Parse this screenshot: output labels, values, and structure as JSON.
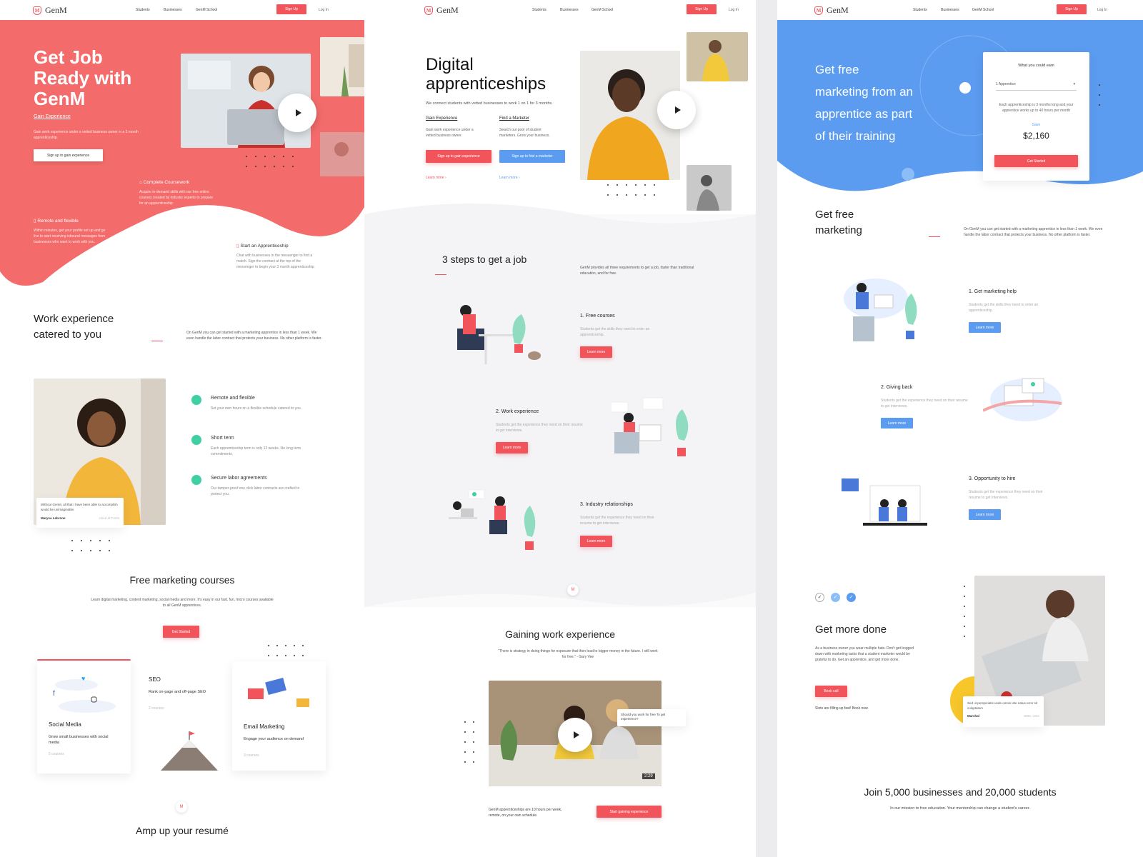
{
  "brand": {
    "name": "GenM"
  },
  "nav": {
    "students": "Students",
    "businesses": "Businesses",
    "school": "GenM School",
    "signup": "Sign Up",
    "login": "Log In"
  },
  "p1": {
    "hero_title_1": "Get Job",
    "hero_title_2": "Ready with",
    "hero_title_3": "GenM",
    "gain": "Gain Experience",
    "gain_text": "Gain work experience under a vetted business owner in a 3 month apprenticeship.",
    "gain_btn": "Sign up to gain experience",
    "coursework": "Complete Coursework",
    "coursework_text": "Acquire in-demand skills with our free online courses created by industry experts to prepare for an apprenticeship.",
    "remote": "Remote and flexible",
    "remote_text": "Within minutes, get your profile set up and go live to start receiving inbound messages from businesses who want to work with you.",
    "start": "Start an Apprenticeship",
    "start_text": "Chat with businesses in the messenger to find a match. Sign the contract at the top of the messenger to begin your 3 month apprenticeship.",
    "work_title_1": "Work experience",
    "work_title_2": "catered to you",
    "work_text": "On GenM you can get started with a marketing apprentice in less than 1 week. We even handle the labor contract that protects your business. No other platform is faster.",
    "quote": "Without GenM, all that I have been able to accomplish would be unimaginable.",
    "quote_name": "Marysa Lebrone",
    "quote_role": "Hired at Forza",
    "f1": "Remote and flexible",
    "f1_text": "Set your own hours on a flexible schedule catered to you.",
    "f2": "Short term",
    "f2_text": "Each apprenticeship term is only 12 weeks. No long term commitments.",
    "f3": "Secure labor agreements",
    "f3_text": "Our tamper-proof one click labor contracts are crafted to protect you.",
    "courses_title": "Free marketing courses",
    "courses_text": "Learn digital marketing, content marketing, social media and more. It's easy in our fast, fun, micro courses available to all GenM apprentices.",
    "courses_btn": "Get Started",
    "c1_title": "Social Media",
    "c1_sub": "Grow small businesses with social media",
    "c1_count": "5 courses",
    "c2_title": "SEO",
    "c2_sub": "Rank on-page and off-page SEO",
    "c2_count": "2 courses",
    "c3_title": "Email Marketing",
    "c3_sub": "Engage your audience on demand",
    "c3_count": "3 courses",
    "amp": "Amp up your resumé"
  },
  "p2": {
    "hero_1": "Digital",
    "hero_2": "apprenticeships",
    "hero_text": "We connect students with vetted businesses to work 1 on 1 for 3 months.",
    "gain": "Gain Experience",
    "gain_text": "Gain work experience under a vetted business owner.",
    "find": "Find a Marketer",
    "find_text": "Search our pool of student marketers. Grow your business.",
    "btn_gain": "Sign up to gain experience",
    "btn_find": "Sign up to find a marketer",
    "learn": "Learn more",
    "steps_title": "3 steps to get a job",
    "steps_text": "GenM provides all three requirements to get a job, faster than traditional education, and for free.",
    "s1": "1. Free courses",
    "s1_text": "Students get the skills they need to enter an apprenticeship.",
    "s2": "2. Work experience",
    "s2_text": "Students get the experience they need on their resume to get interviews.",
    "s3": "3. Industry relationships",
    "s3_text": "Students get the experience they need on their resume to get interviews.",
    "learn_btn": "Learn more",
    "gaining_title": "Gaining work experience",
    "gaining_quote": "\"There is strategy in doing things for exposure that then lead to bigger money in the future. I still work for free.\" - Gary Vee",
    "bubble": "Should you work for free To get experience?",
    "duration": "2:29",
    "foot_text": "GenM apprenticeships are 10 hours per week, remote, on your own schedule.",
    "foot_btn": "Start gaining experience"
  },
  "p3": {
    "hero_1": "Get free",
    "hero_2": "marketing from an",
    "hero_3": "apprentice as part",
    "hero_4": "of their training",
    "earn_title": "What you could earn",
    "earn_select": "1 Apprentice",
    "earn_text": "Each apprenticeship is 3 months long and your apprentice works up to 40 hours per month",
    "save": "Save",
    "amount": "$2,160",
    "earn_btn": "Get Started",
    "free_1": "Get free",
    "free_2": "marketing",
    "free_text": "On GenM you can get started with a marketing apprentice in less than 1 week. We even handle the labor contract that protects your business. No other platform is faster.",
    "b1": "1. Get marketing help",
    "b1_text": "Students get the skills they need to enter an apprenticeship.",
    "b2": "2. Giving back",
    "b2_text": "Students get the experience they need on their resume to get interviews.",
    "b3": "3. Opportunity to hire",
    "b3_text": "Students get the experience they need on their resume to get interviews.",
    "learn_btn": "Learn more",
    "more_title": "Get more done",
    "more_text": "As a business owner you wear multiple hats. Don't get bogged down with marketing tasks that a student marketer would be grateful to do. Get an apprentice, and get more done.",
    "book": "Book call",
    "slots": "Slots are filling up fast! Book now.",
    "review": "Sed ut perspiciatis unde omnis iste natus error sit voluptatem",
    "review_name": "Marshal",
    "review_role": "SMC, USA",
    "join_title": "Join 5,000 businesses and 20,000 students",
    "join_text": "In our mission to free education. Your mentorship can change a student's career."
  },
  "colors": {
    "red": "#f2545b",
    "blue": "#5b9cf0",
    "green": "#3fcfa3"
  }
}
